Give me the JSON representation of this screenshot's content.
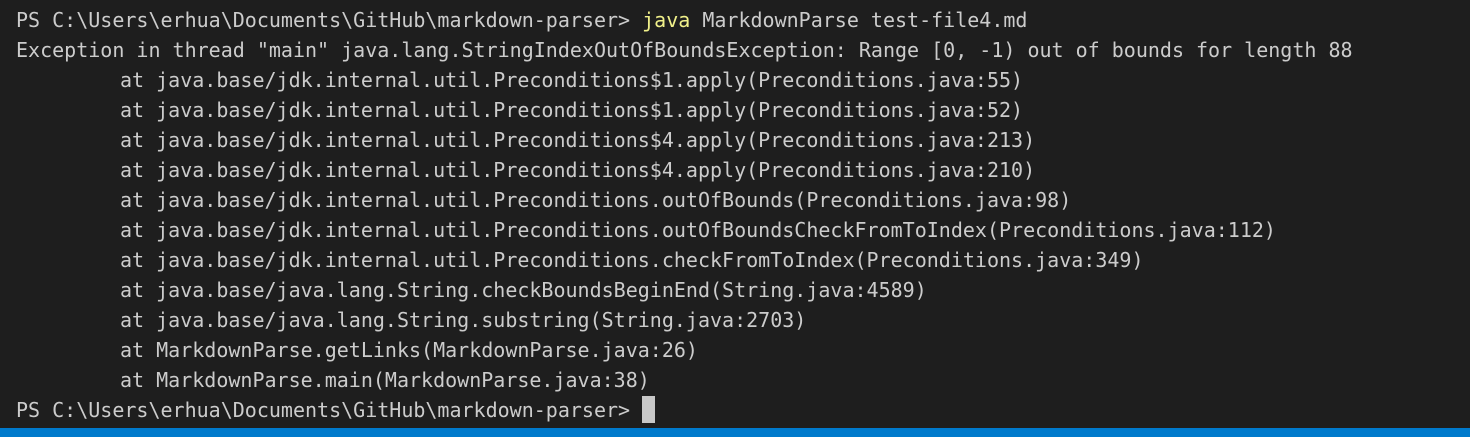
{
  "terminal": {
    "command_line": {
      "prompt": "PS C:\\Users\\erhua\\Documents\\GitHub\\markdown-parser> ",
      "command": "java",
      "args": " MarkdownParse test-file4.md"
    },
    "exception_line": "Exception in thread \"main\" java.lang.StringIndexOutOfBoundsException: Range [0, -1) out of bounds for length 88",
    "stack_trace": [
      "at java.base/jdk.internal.util.Preconditions$1.apply(Preconditions.java:55)",
      "at java.base/jdk.internal.util.Preconditions$1.apply(Preconditions.java:52)",
      "at java.base/jdk.internal.util.Preconditions$4.apply(Preconditions.java:213)",
      "at java.base/jdk.internal.util.Preconditions$4.apply(Preconditions.java:210)",
      "at java.base/jdk.internal.util.Preconditions.outOfBounds(Preconditions.java:98)",
      "at java.base/jdk.internal.util.Preconditions.outOfBoundsCheckFromToIndex(Preconditions.java:112)",
      "at java.base/jdk.internal.util.Preconditions.checkFromToIndex(Preconditions.java:349)",
      "at java.base/java.lang.String.checkBoundsBeginEnd(String.java:4589)",
      "at java.base/java.lang.String.substring(String.java:2703)",
      "at MarkdownParse.getLinks(MarkdownParse.java:26)",
      "at MarkdownParse.main(MarkdownParse.java:38)"
    ],
    "final_prompt": "PS C:\\Users\\erhua\\Documents\\GitHub\\markdown-parser>"
  },
  "colors": {
    "background": "#1e1e1e",
    "text": "#cccccc",
    "command": "#f0f08a",
    "status_strip": "#007acc",
    "cursor": "#c8c8c8"
  }
}
